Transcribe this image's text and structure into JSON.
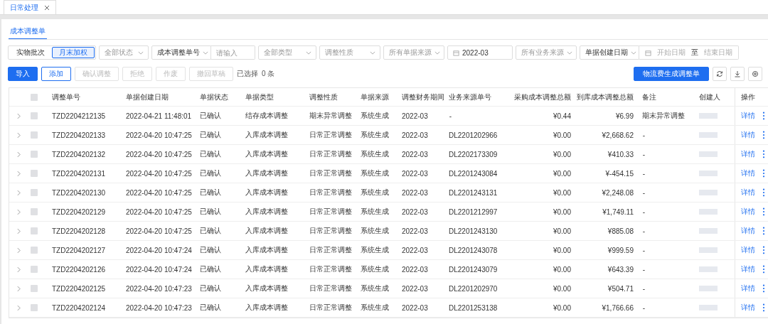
{
  "window_tabs": [
    {
      "label": "日常处理",
      "selected": true
    }
  ],
  "page_tabs": [
    {
      "label": "成本调整单",
      "selected": true
    }
  ],
  "filters": {
    "mode_options": [
      {
        "label": "实物批次",
        "selected": false
      },
      {
        "label": "月末加权",
        "selected": true
      }
    ],
    "status_select": "全部状态",
    "number_select": "成本调整单号",
    "number_input": {
      "placeholder": "请输入"
    },
    "type_select": "全部类型",
    "nature_select": "调整性质",
    "doc_source_select": "所有单据来源",
    "period_field": "2022-03",
    "biz_source_select": "所有业务来源",
    "date_type_select": "单据创建日期",
    "date_range": {
      "start_placeholder": "开始日期",
      "separator": "至",
      "end_placeholder": "结束日期"
    }
  },
  "actions": [
    {
      "label": "导入",
      "kind": "primary",
      "disabled": false
    },
    {
      "label": "添加",
      "kind": "outline",
      "disabled": false
    },
    {
      "label": "确认调整",
      "kind": "plain",
      "disabled": true
    },
    {
      "label": "拒绝",
      "kind": "plain",
      "disabled": true
    },
    {
      "label": "作废",
      "kind": "plain",
      "disabled": true
    },
    {
      "label": "撤回草稿",
      "kind": "plain",
      "disabled": true
    }
  ],
  "selection_info": {
    "label": "已选择",
    "count": "0 条"
  },
  "generate_button": "物流费生成调整单",
  "table": {
    "header_checked": false,
    "columns": [
      "调整单号",
      "单据创建日期",
      "单据状态",
      "单据类型",
      "调整性质",
      "单据来源",
      "调整财务期间",
      "业务来源单号",
      "采购成本调整总额",
      "到库成本调整总额",
      "备注",
      "创建人",
      "操作"
    ],
    "rows": [
      {
        "checked": false,
        "cells": [
          "TZD2204212135",
          "2022-04-21 11:48:01",
          "已确认",
          "结存成本调整",
          "期末异常调整",
          "系统生成",
          "2022-03",
          "-",
          "¥0.44",
          "¥6.99",
          "期末异常调整"
        ],
        "action": "详情"
      },
      {
        "checked": false,
        "cells": [
          "TZD2204202133",
          "2022-04-20 10:47:25",
          "已确认",
          "入库成本调整",
          "日常正常调整",
          "系统生成",
          "2022-03",
          "DL2201202966",
          "¥0.00",
          "¥2,668.62",
          "-"
        ],
        "action": "详情"
      },
      {
        "checked": false,
        "cells": [
          "TZD2204202132",
          "2022-04-20 10:47:25",
          "已确认",
          "入库成本调整",
          "日常正常调整",
          "系统生成",
          "2022-03",
          "DL2202173309",
          "¥0.00",
          "¥410.33",
          "-"
        ],
        "action": "详情"
      },
      {
        "checked": false,
        "cells": [
          "TZD2204202131",
          "2022-04-20 10:47:25",
          "已确认",
          "入库成本调整",
          "日常正常调整",
          "系统生成",
          "2022-03",
          "DL2201243084",
          "¥0.00",
          "¥-454.15",
          "-"
        ],
        "action": "详情"
      },
      {
        "checked": false,
        "cells": [
          "TZD2204202130",
          "2022-04-20 10:47:25",
          "已确认",
          "入库成本调整",
          "日常正常调整",
          "系统生成",
          "2022-03",
          "DL2201243131",
          "¥0.00",
          "¥2,248.08",
          "-"
        ],
        "action": "详情"
      },
      {
        "checked": false,
        "cells": [
          "TZD2204202129",
          "2022-04-20 10:47:25",
          "已确认",
          "入库成本调整",
          "日常正常调整",
          "系统生成",
          "2022-03",
          "DL2201212997",
          "¥0.00",
          "¥1,749.11",
          "-"
        ],
        "action": "详情"
      },
      {
        "checked": false,
        "cells": [
          "TZD2204202128",
          "2022-04-20 10:47:25",
          "已确认",
          "入库成本调整",
          "日常正常调整",
          "系统生成",
          "2022-03",
          "DL2201243130",
          "¥0.00",
          "¥885.08",
          "-"
        ],
        "action": "详情"
      },
      {
        "checked": false,
        "cells": [
          "TZD2204202127",
          "2022-04-20 10:47:24",
          "已确认",
          "入库成本调整",
          "日常正常调整",
          "系统生成",
          "2022-03",
          "DL2201243078",
          "¥0.00",
          "¥999.59",
          "-"
        ],
        "action": "详情"
      },
      {
        "checked": false,
        "cells": [
          "TZD2204202126",
          "2022-04-20 10:47:24",
          "已确认",
          "入库成本调整",
          "日常正常调整",
          "系统生成",
          "2022-03",
          "DL2201243079",
          "¥0.00",
          "¥643.39",
          "-"
        ],
        "action": "详情"
      },
      {
        "checked": false,
        "cells": [
          "TZD2204202125",
          "2022-04-20 10:47:23",
          "已确认",
          "入库成本调整",
          "日常正常调整",
          "系统生成",
          "2022-03",
          "DL2201202970",
          "¥0.00",
          "¥504.71",
          "-"
        ],
        "action": "详情"
      },
      {
        "checked": false,
        "cells": [
          "TZD2204202124",
          "2022-04-20 10:47:23",
          "已确认",
          "入库成本调整",
          "日常正常调整",
          "系统生成",
          "2022-03",
          "DL2201253138",
          "¥0.00",
          "¥1,766.66",
          "-"
        ],
        "action": "详情"
      }
    ]
  }
}
